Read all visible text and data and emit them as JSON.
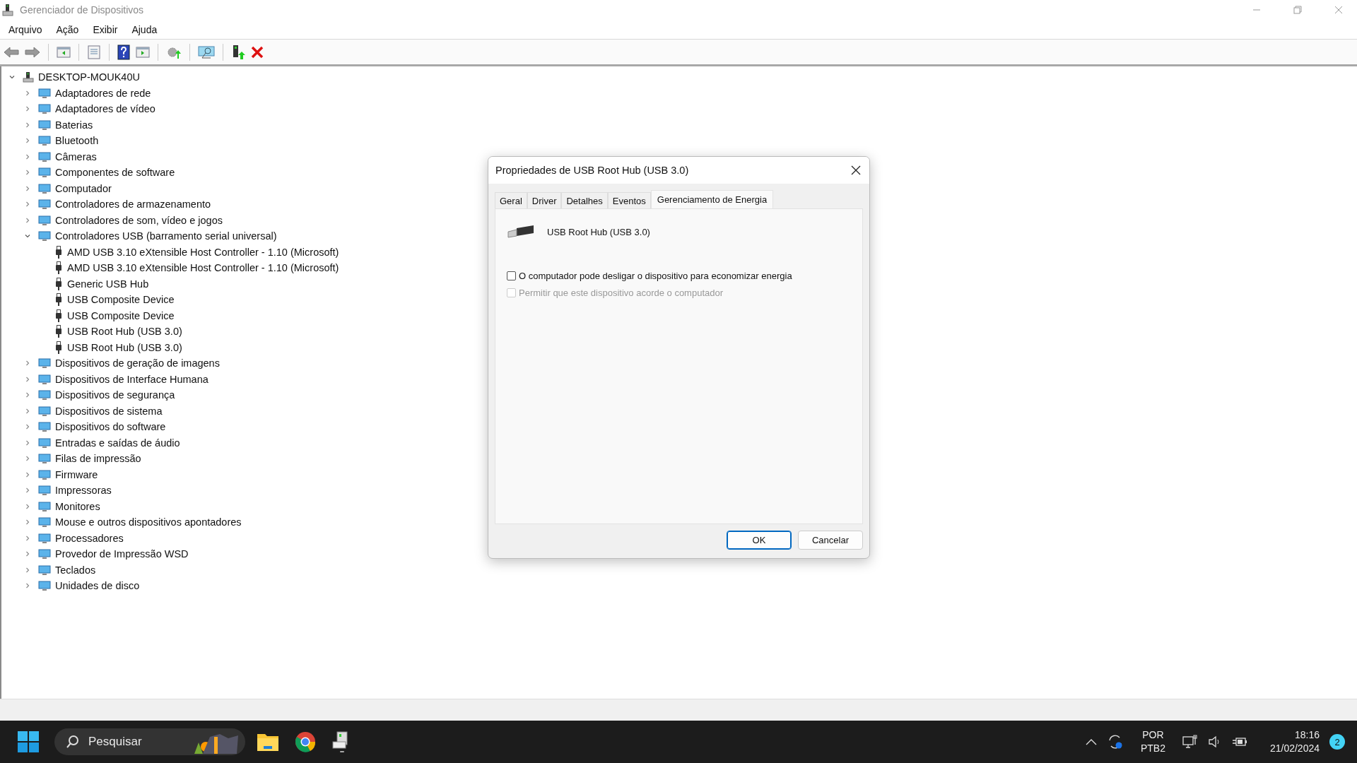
{
  "window": {
    "title": "Gerenciador de Dispositivos"
  },
  "menu": [
    "Arquivo",
    "Ação",
    "Exibir",
    "Ajuda"
  ],
  "tree": {
    "label": "DESKTOP-MOUK40U",
    "expanded": true,
    "children": [
      {
        "label": "Adaptadores de rede",
        "expanded": false
      },
      {
        "label": "Adaptadores de vídeo",
        "expanded": false
      },
      {
        "label": "Baterias",
        "expanded": false
      },
      {
        "label": "Bluetooth",
        "expanded": false
      },
      {
        "label": "Câmeras",
        "expanded": false
      },
      {
        "label": "Componentes de software",
        "expanded": false
      },
      {
        "label": "Computador",
        "expanded": false
      },
      {
        "label": "Controladores de armazenamento",
        "expanded": false
      },
      {
        "label": "Controladores de som, vídeo e jogos",
        "expanded": false
      },
      {
        "label": "Controladores USB (barramento serial universal)",
        "expanded": true,
        "children": [
          {
            "label": "AMD USB 3.10 eXtensible Host Controller - 1.10 (Microsoft)"
          },
          {
            "label": "AMD USB 3.10 eXtensible Host Controller - 1.10 (Microsoft)"
          },
          {
            "label": "Generic USB Hub"
          },
          {
            "label": "USB Composite Device"
          },
          {
            "label": "USB Composite Device"
          },
          {
            "label": "USB Root Hub (USB 3.0)"
          },
          {
            "label": "USB Root Hub (USB 3.0)"
          }
        ]
      },
      {
        "label": "Dispositivos de geração de imagens",
        "expanded": false
      },
      {
        "label": "Dispositivos de Interface Humana",
        "expanded": false
      },
      {
        "label": "Dispositivos de segurança",
        "expanded": false
      },
      {
        "label": "Dispositivos de sistema",
        "expanded": false
      },
      {
        "label": "Dispositivos do software",
        "expanded": false
      },
      {
        "label": "Entradas e saídas de áudio",
        "expanded": false
      },
      {
        "label": "Filas de impressão",
        "expanded": false
      },
      {
        "label": "Firmware",
        "expanded": false
      },
      {
        "label": "Impressoras",
        "expanded": false
      },
      {
        "label": "Monitores",
        "expanded": false
      },
      {
        "label": "Mouse e outros dispositivos apontadores",
        "expanded": false
      },
      {
        "label": "Processadores",
        "expanded": false
      },
      {
        "label": "Provedor de Impressão WSD",
        "expanded": false
      },
      {
        "label": "Teclados",
        "expanded": false
      },
      {
        "label": "Unidades de disco",
        "expanded": false
      }
    ]
  },
  "dialog": {
    "title": "Propriedades de USB Root Hub (USB 3.0)",
    "tabs": [
      {
        "label": "Geral",
        "selected": false
      },
      {
        "label": "Driver",
        "selected": false
      },
      {
        "label": "Detalhes",
        "selected": false
      },
      {
        "label": "Eventos",
        "selected": false
      },
      {
        "label": "Gerenciamento de Energia",
        "selected": true
      }
    ],
    "device_name": "USB Root Hub (USB 3.0)",
    "options": [
      {
        "label": "O computador pode desligar o dispositivo para economizar energia",
        "checked": false,
        "disabled": false
      },
      {
        "label": "Permitir que este dispositivo acorde o computador",
        "checked": false,
        "disabled": true
      }
    ],
    "buttons": [
      {
        "label": "OK",
        "default": true
      },
      {
        "label": "Cancelar",
        "default": false
      }
    ]
  },
  "taskbar": {
    "search": {
      "placeholder": "Pesquisar"
    },
    "language": "POR",
    "layout": "PTB2",
    "time": "18:16",
    "date": "21/02/2024",
    "notifications": "2"
  }
}
